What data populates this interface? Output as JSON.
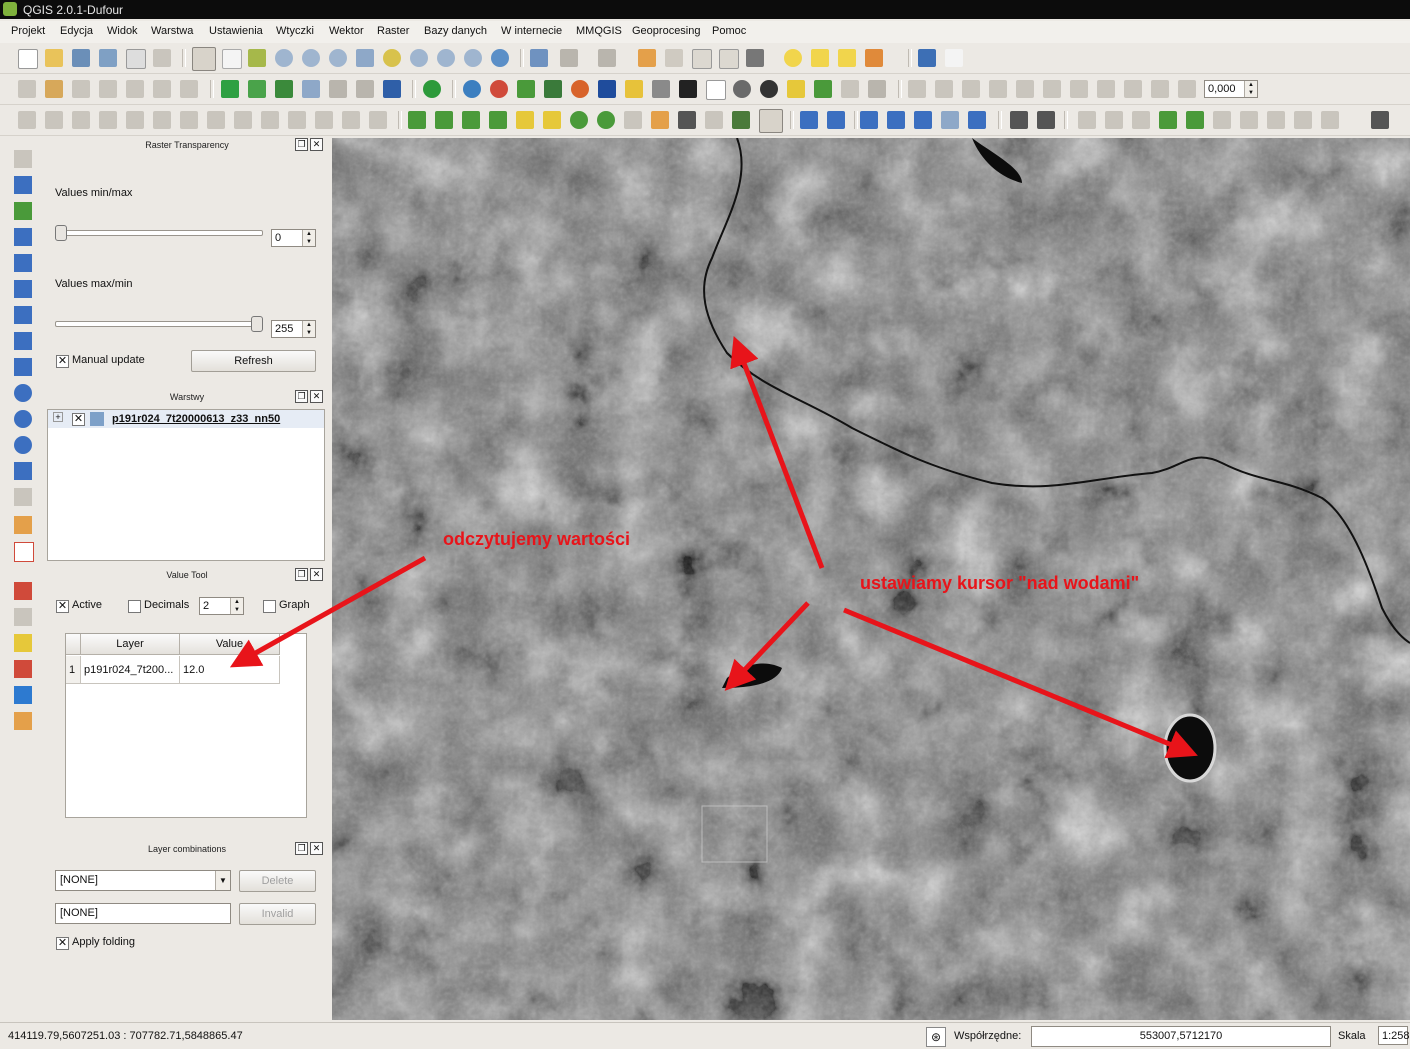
{
  "window": {
    "title": "QGIS 2.0.1-Dufour"
  },
  "menu": [
    "Projekt",
    "Edycja",
    "Widok",
    "Warstwa",
    "Ustawienia",
    "Wtyczki",
    "Wektor",
    "Raster",
    "Bazy danych",
    "W internecie",
    "MMQGIS",
    "Geoprocesing",
    "Pomoc"
  ],
  "toolbar2": {
    "rotation_value": "0,000"
  },
  "raster_transparency": {
    "title": "Raster Transparency",
    "min_max_label": "Values min/max",
    "min_value": "0",
    "max_min_label": "Values max/min",
    "max_value": "255",
    "manual_update_label": "Manual update",
    "refresh_label": "Refresh",
    "min_slider_fraction": 0.0,
    "max_slider_fraction": 1.0
  },
  "layers_panel": {
    "title": "Warstwy",
    "layers": [
      {
        "name": "p191r024_7t20000613_z33_nn50"
      }
    ]
  },
  "value_tool": {
    "title": "Value Tool",
    "active_label": "Active",
    "decimals_label": "Decimals",
    "decimals_value": "2",
    "graph_label": "Graph",
    "columns": [
      "Layer",
      "Value"
    ],
    "rows": [
      {
        "index": "1",
        "layer": "p191r024_7t200...",
        "value": "12.0"
      }
    ]
  },
  "layer_combinations": {
    "title": "Layer combinations",
    "combo_value": "[NONE]",
    "delete_label": "Delete",
    "name_value": "[NONE]",
    "invalid_label": "Invalid",
    "apply_folding_label": "Apply folding"
  },
  "map": {
    "annotation_left": "odczytujemy wartości",
    "annotation_right": "ustawiamy kursor \"nad wodami\"",
    "arrow_color": "#e8141a"
  },
  "status": {
    "extents": "414119.79,5607251.03 : 707782.71,5848865.47",
    "coord_label": "Współrzędne:",
    "coord_value": "553007,5712170",
    "scale_label": "Skala",
    "scale_value": "1:258"
  }
}
